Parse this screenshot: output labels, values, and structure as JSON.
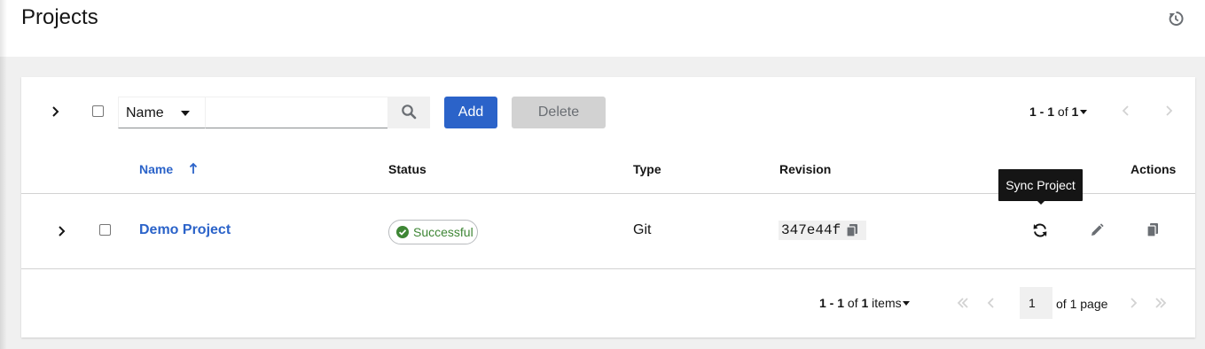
{
  "page": {
    "title": "Projects",
    "history_icon": "history-icon"
  },
  "toolbar": {
    "expand_icon": "chevron-right-icon",
    "search_field_label": "Name",
    "search_value": "",
    "search_icon": "search-icon",
    "add_label": "Add",
    "delete_label": "Delete",
    "pagination": {
      "range": "1 - 1",
      "of_label": "of",
      "total": "1"
    }
  },
  "table": {
    "columns": {
      "name": "Name",
      "status": "Status",
      "type": "Type",
      "revision": "Revision",
      "actions": "Actions"
    },
    "sort_icon": "sort-ascending-icon",
    "rows": [
      {
        "name": "Demo Project",
        "status": "Successful",
        "type": "Git",
        "revision": "347e44f",
        "actions": [
          "sync-icon",
          "edit-icon",
          "copy-icon"
        ]
      }
    ]
  },
  "tooltip": {
    "text": "Sync Project"
  },
  "bottom_pagination": {
    "range": "1 - 1",
    "of_label": "of",
    "total": "1",
    "items_label": "items",
    "current_page": "1",
    "of_page_label": "of 1 page"
  },
  "colors": {
    "accent": "#2b63c9",
    "success": "#3e8635",
    "disabled_bg": "#d2d2d2",
    "background": "#f0f0f0"
  }
}
